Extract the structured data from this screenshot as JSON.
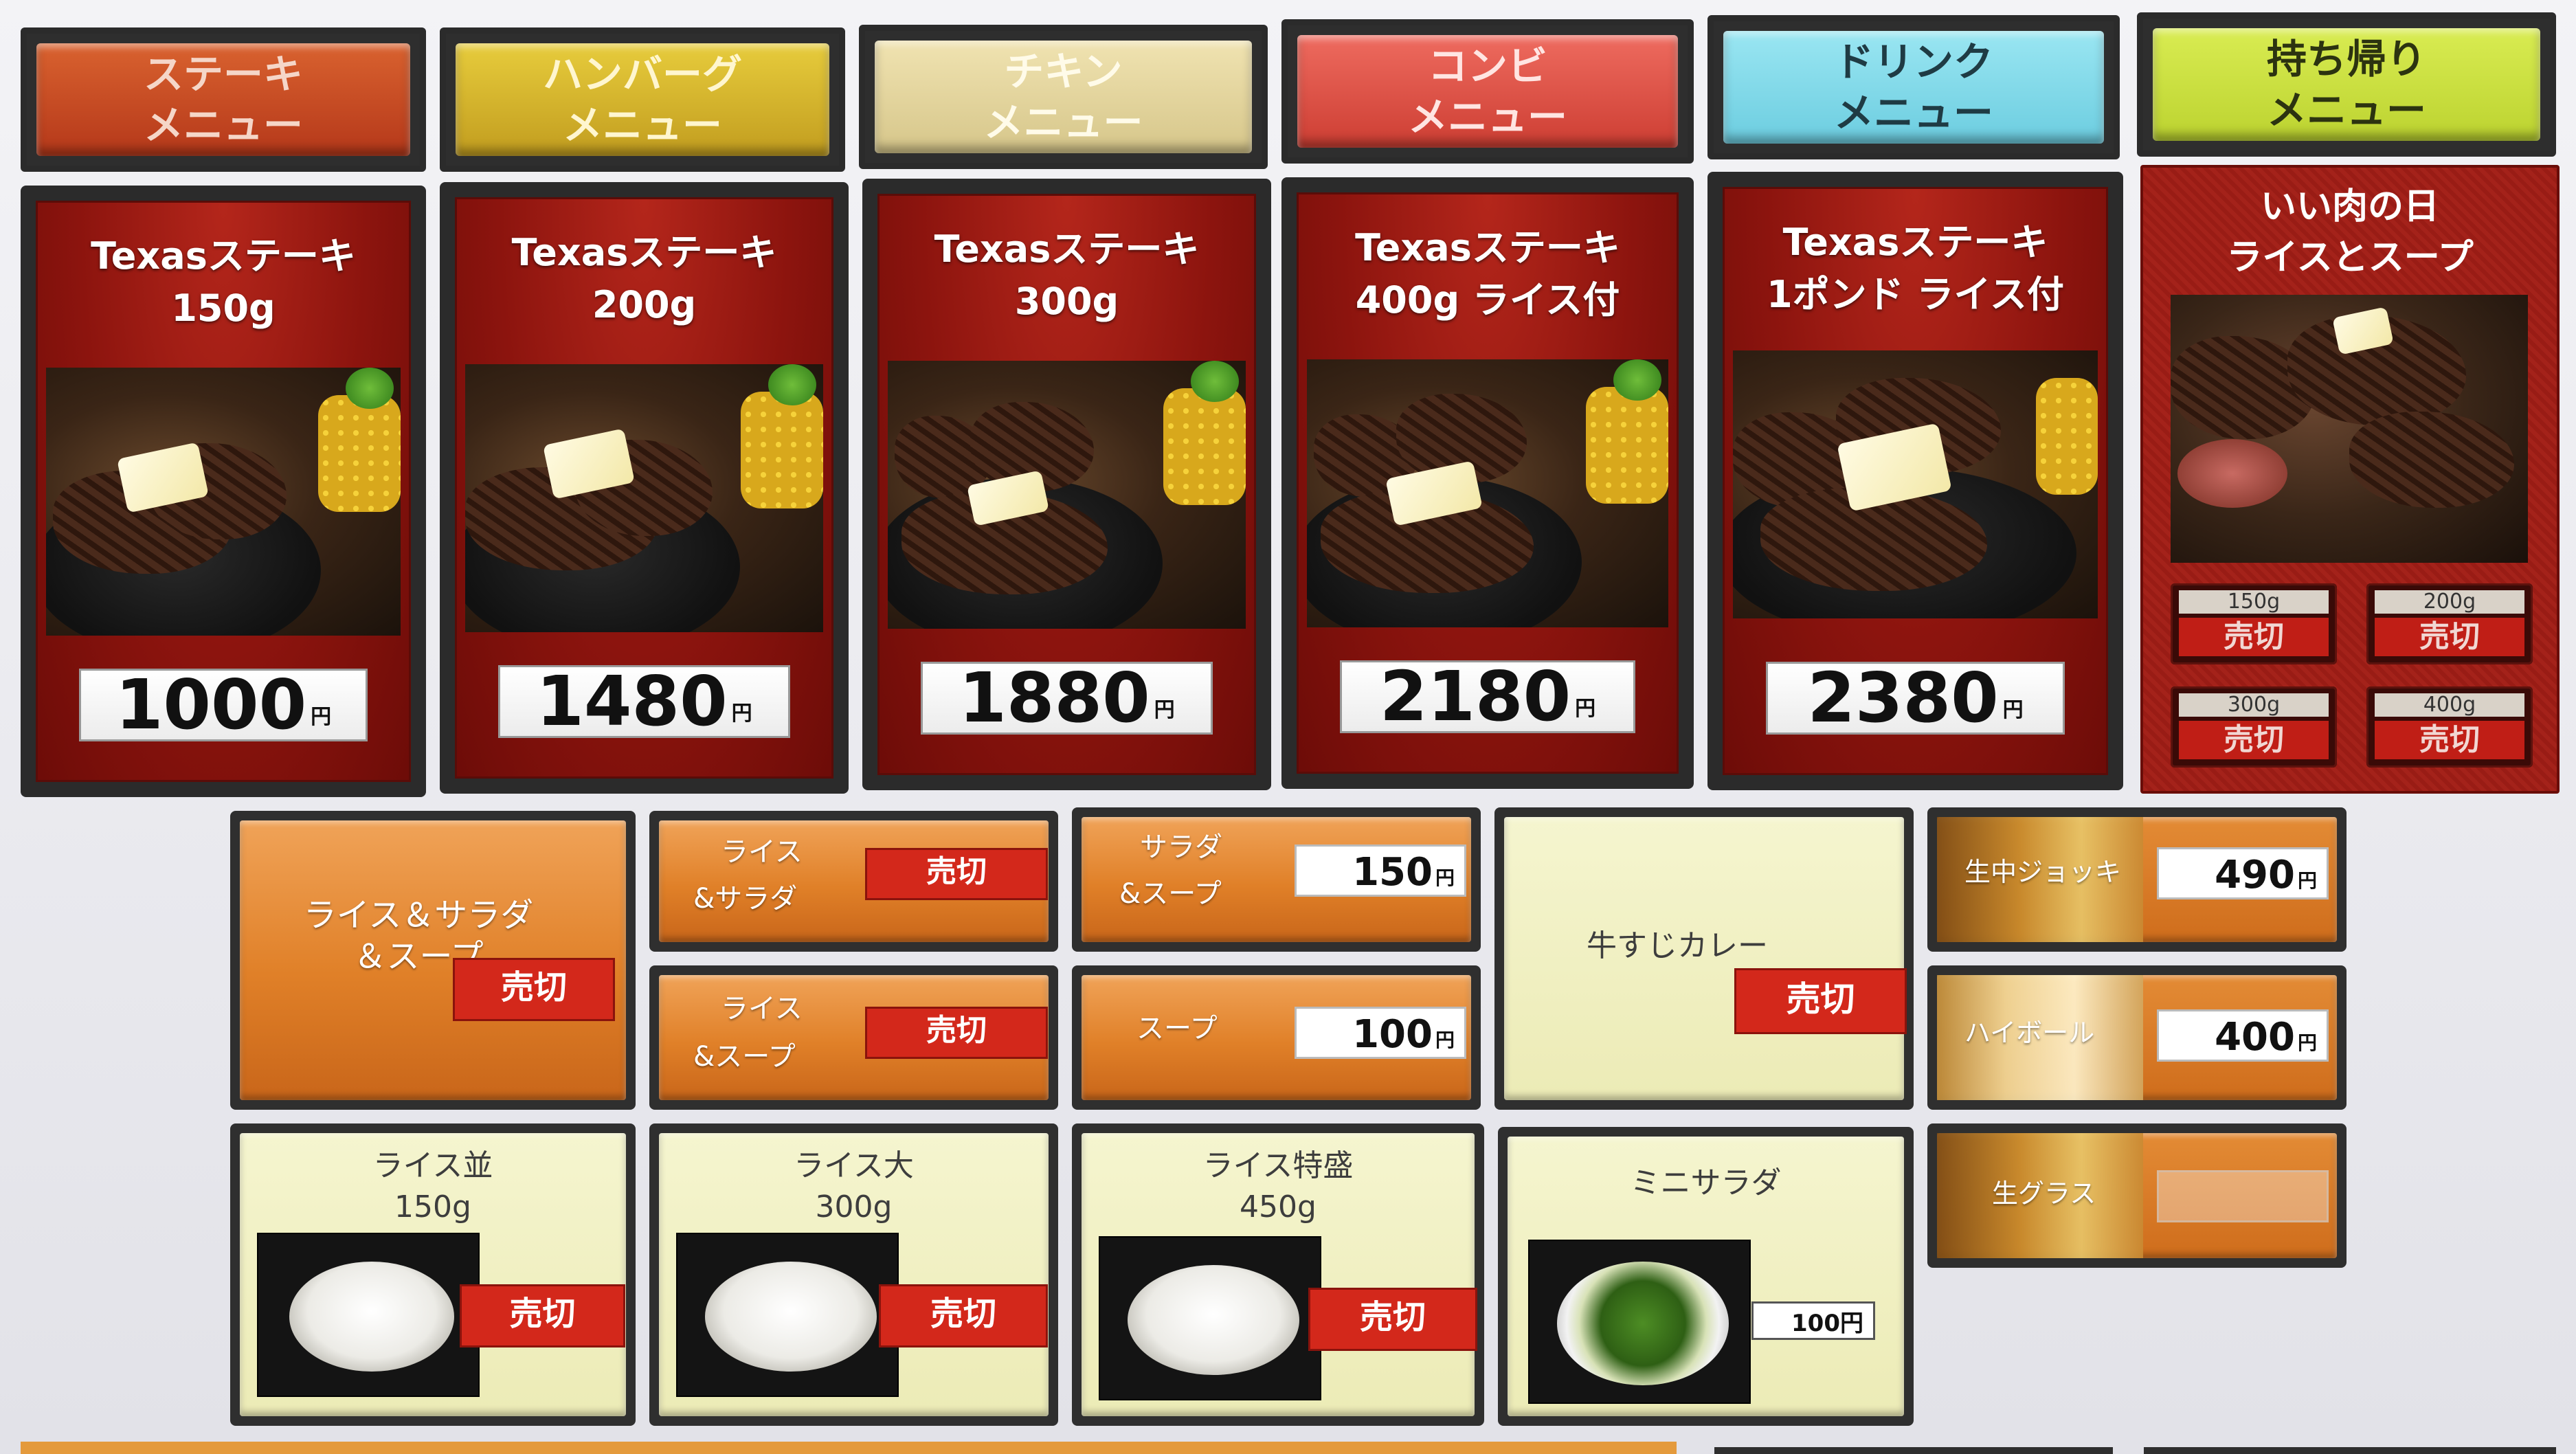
{
  "tabs": [
    {
      "line1": "ステーキ",
      "line2": "メニュー",
      "color": "#c5471e"
    },
    {
      "line1": "ハンバーグ",
      "line2": "メニュー",
      "color": "#d4b52a"
    },
    {
      "line1": "チキン",
      "line2": "メニュー",
      "color": "#e2d39a"
    },
    {
      "line1": "コンビ",
      "line2": "メニュー",
      "color": "#df5347"
    },
    {
      "line1": "ドリンク",
      "line2": "メニュー",
      "color": "#7fd8e8"
    },
    {
      "line1": "持ち帰り",
      "line2": "メニュー",
      "color": "#c9e040"
    }
  ],
  "steaks": [
    {
      "line1": "Texasステーキ",
      "line2": "150g",
      "price": "1000",
      "yen": "円"
    },
    {
      "line1": "Texasステーキ",
      "line2": "200g",
      "price": "1480",
      "yen": "円"
    },
    {
      "line1": "Texasステーキ",
      "line2": "300g",
      "price": "1880",
      "yen": "円"
    },
    {
      "line1": "Texasステーキ",
      "line2": "400g ライス付",
      "price": "2180",
      "yen": "円"
    },
    {
      "line1": "Texasステーキ",
      "line2": "1ポンド ライス付",
      "price": "2380",
      "yen": "円"
    }
  ],
  "takeout": {
    "line1": "いい肉の日",
    "line2": "ライスとスープ",
    "options": [
      {
        "weight": "150g",
        "status": "売切"
      },
      {
        "weight": "200g",
        "status": "売切"
      },
      {
        "weight": "300g",
        "status": "売切"
      },
      {
        "weight": "400g",
        "status": "売切"
      }
    ]
  },
  "sides": {
    "rice_salad_soup": {
      "line1": "ライス＆サラダ",
      "line2": "＆スープ",
      "status": "売切"
    },
    "rice_salad": {
      "line1": "ライス",
      "line2": "&サラダ",
      "status": "売切"
    },
    "rice_soup": {
      "line1": "ライス",
      "line2": "&スープ",
      "status": "売切"
    },
    "salad_soup": {
      "line1": "サラダ",
      "line2": "&スープ",
      "price": "150",
      "yen": "円"
    },
    "soup": {
      "label": "スープ",
      "price": "100",
      "yen": "円"
    },
    "beef_curry": {
      "label": "牛すじカレー",
      "status": "売切"
    }
  },
  "drinks": [
    {
      "label": "生中ジョッキ",
      "price": "490",
      "yen": "円"
    },
    {
      "label": "ハイボール",
      "price": "400",
      "yen": "円"
    },
    {
      "label": "生グラス",
      "price": "",
      "yen": ""
    }
  ],
  "rice": [
    {
      "line1": "ライス並",
      "line2": "150g",
      "status": "売切"
    },
    {
      "line1": "ライス大",
      "line2": "300g",
      "status": "売切"
    },
    {
      "line1": "ライス特盛",
      "line2": "450g",
      "status": "売切"
    }
  ],
  "mini_salad": {
    "label": "ミニサラダ",
    "price": "100円"
  }
}
